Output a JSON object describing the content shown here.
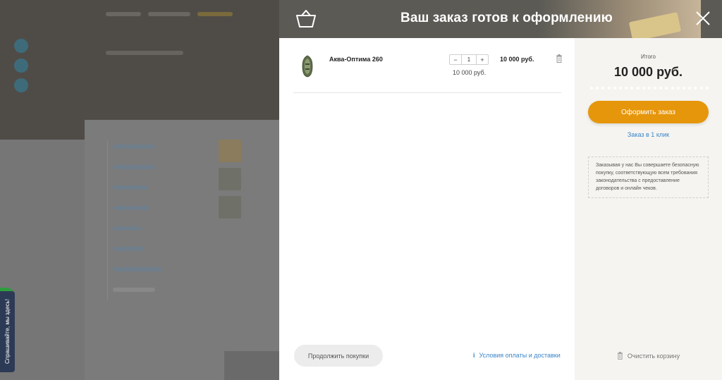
{
  "modal": {
    "title": "Ваш заказ готов к оформлению"
  },
  "cart": {
    "items": [
      {
        "name": "Аква-Оптима 260",
        "quantity": "1",
        "unit_price": "10 000 руб.",
        "total": "10 000 руб.",
        "minus_label": "−",
        "plus_label": "+"
      }
    ],
    "continue_label": "Продолжить покупки",
    "terms_label": "Условия оплаты и доставки",
    "info_glyph": "i"
  },
  "summary": {
    "total_label": "Итого",
    "total_value": "10 000 руб.",
    "checkout_label": "Оформить заказ",
    "one_click_label": "Заказ в 1 клик",
    "note": "Заказывая у нас Вы совершаете безопасную покупку, соответствующую всем требования законодательства с предоставление договоров и онлайн чеков.",
    "clear_label": "Очистить корзину"
  },
  "side_widget": {
    "label": "Спрашивайте, мы здесь!"
  },
  "colors": {
    "accent": "#e6960a",
    "link": "#3a85c7",
    "header": "#5b5a55",
    "arrow": "#e41e1e"
  },
  "icons": [
    "basket-icon",
    "close-icon",
    "trash-icon",
    "info-icon",
    "arrow-right-icon"
  ]
}
